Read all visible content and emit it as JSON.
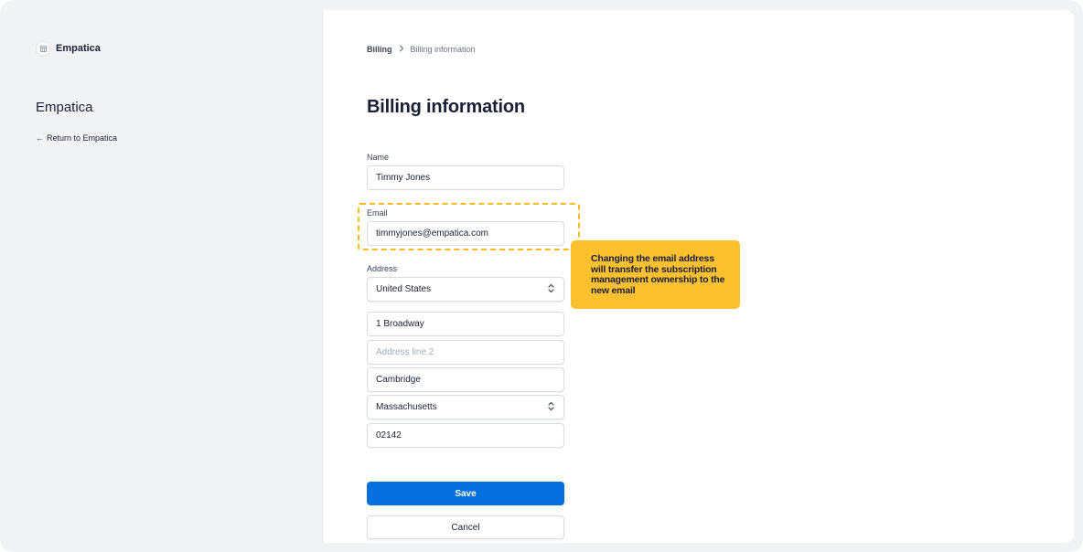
{
  "sidebar": {
    "brand_name": "Empatica",
    "title": "Empatica",
    "return_arrow": "←",
    "return_label": "Return to Empatica"
  },
  "breadcrumb": {
    "items": [
      "Billing",
      "Billing information"
    ],
    "separator_icon": "chevron-right-icon"
  },
  "page": {
    "title": "Billing information"
  },
  "form": {
    "name_label": "Name",
    "name_value": "Timmy Jones",
    "email_label": "Email",
    "email_value": "timmyjones@empatica.com",
    "address_label": "Address",
    "country_value": "United States",
    "line1_value": "1 Broadway",
    "line2_placeholder": "Address line 2",
    "city_value": "Cambridge",
    "state_value": "Massachusetts",
    "zip_value": "02142",
    "save_label": "Save",
    "cancel_label": "Cancel"
  },
  "annotation": {
    "text": "Changing the email address will transfer the subscription management ownership to the new email"
  },
  "colors": {
    "primary": "#0570de",
    "callout": "#fbc02d",
    "dash": "#f9bb1c",
    "sidebar_bg": "#f2f3f5"
  }
}
